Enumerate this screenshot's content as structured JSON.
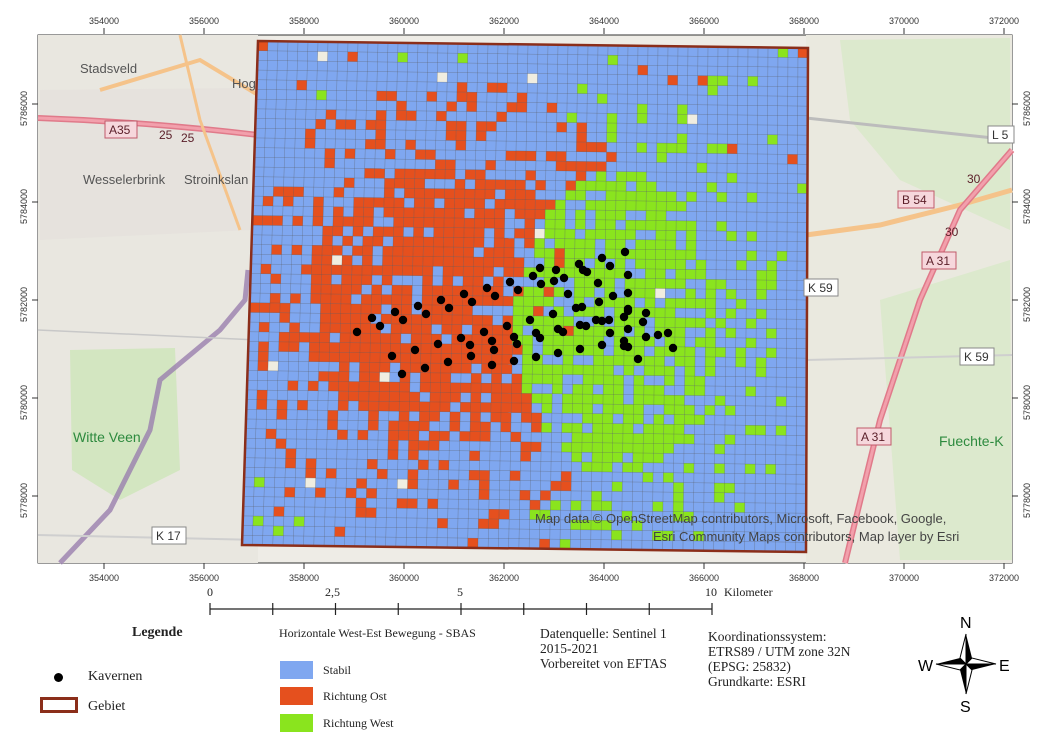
{
  "map": {
    "x_ticks": [
      "354000",
      "356000",
      "358000",
      "360000",
      "362000",
      "364000",
      "366000",
      "368000",
      "370000",
      "372000"
    ],
    "y_ticks": [
      "5786000",
      "5784000",
      "5782000",
      "5780000",
      "5778000"
    ],
    "place_labels": [
      {
        "id": "stadsveld",
        "text": "Stadsveld"
      },
      {
        "id": "hog",
        "text": "Hog"
      },
      {
        "id": "wesselerbrink",
        "text": "Wesselerbrink"
      },
      {
        "id": "stroinkslan",
        "text": "Stroinkslan"
      },
      {
        "id": "witte-veen",
        "text": "Witte Veen"
      },
      {
        "id": "fuechte",
        "text": "Fuechte-K"
      }
    ],
    "road_labels": [
      {
        "id": "a35",
        "text": "A35"
      },
      {
        "id": "n25a",
        "text": "25"
      },
      {
        "id": "n25b",
        "text": "25"
      },
      {
        "id": "l5",
        "text": "L 5"
      },
      {
        "id": "b54",
        "text": "B 54"
      },
      {
        "id": "n30a",
        "text": "30"
      },
      {
        "id": "n30b",
        "text": "30"
      },
      {
        "id": "a31a",
        "text": "A 31"
      },
      {
        "id": "a31b",
        "text": "A 31"
      },
      {
        "id": "k59a",
        "text": "K 59"
      },
      {
        "id": "k59b",
        "text": "K 59"
      },
      {
        "id": "k17",
        "text": "K 17"
      }
    ],
    "attribution_line1": "Map data © OpenStreetMap contributors, Microsoft, Facebook, Google,",
    "attribution_line2": "Esri Community Maps contributors, Map layer by Esri",
    "colors": {
      "stabil": "#7fa7f0",
      "ost": "#e5501e",
      "west": "#8ae41e",
      "gebiet_border": "#8b2e1a",
      "basemap": "#eeece6",
      "grid_line": "#555555"
    }
  },
  "scalebar": {
    "ticks": [
      "0",
      "2,5",
      "5",
      "10"
    ],
    "unit": "Kilometer"
  },
  "legend": {
    "title": "Legende",
    "kavernen": "Kavernen",
    "gebiet": "Gebiet",
    "sbas_title": "Horizontale West-Est Bewegung - SBAS",
    "stabil": "Stabil",
    "ost": "Richtung Ost",
    "west": "Richtung West"
  },
  "source": {
    "line1": "Datenquelle: Sentinel 1",
    "line2": "2015-2021",
    "line3": "Vorbereitet von EFTAS"
  },
  "crs": {
    "line1": "Koordinationssystem:",
    "line2": "ETRS89 / UTM zone 32N",
    "line3": "(EPSG: 25832)",
    "line4": "Grundkarte: ESRI"
  },
  "north_arrow": {
    "n": "N",
    "e": "E",
    "s": "S",
    "w": "W"
  }
}
